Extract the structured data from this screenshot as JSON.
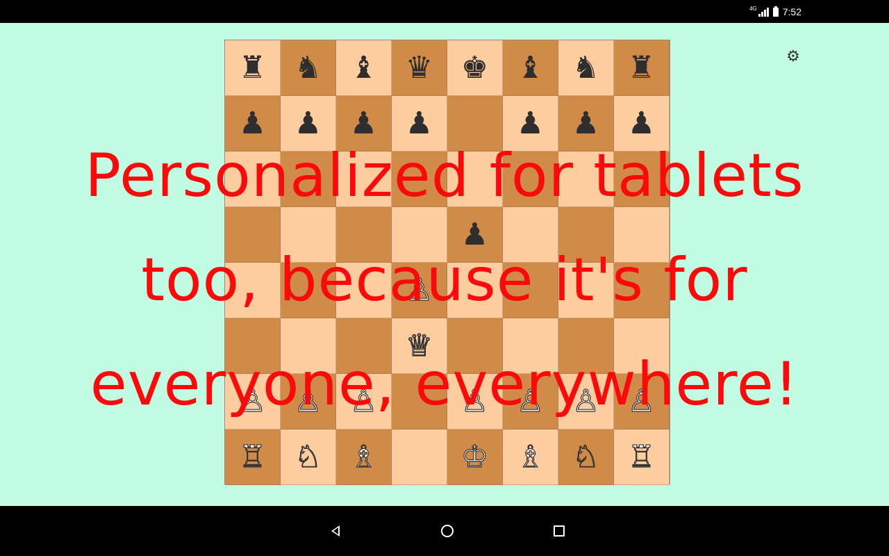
{
  "status_bar": {
    "network_label": "4G",
    "time": "7:52"
  },
  "toolbar": {
    "settings_icon": "gear-icon"
  },
  "board": {
    "light_color": "#fecd9f",
    "dark_color": "#d08b48",
    "rows": [
      [
        {
          "g": "♜",
          "c": "b"
        },
        {
          "g": "♞",
          "c": "b"
        },
        {
          "g": "♝",
          "c": "b"
        },
        {
          "g": "♛",
          "c": "b"
        },
        {
          "g": "♚",
          "c": "b"
        },
        {
          "g": "♝",
          "c": "b"
        },
        {
          "g": "♞",
          "c": "b"
        },
        {
          "g": "♜",
          "c": "b"
        }
      ],
      [
        {
          "g": "♟",
          "c": "b"
        },
        {
          "g": "♟",
          "c": "b"
        },
        {
          "g": "♟",
          "c": "b"
        },
        {
          "g": "♟",
          "c": "b"
        },
        {
          "g": "",
          "c": ""
        },
        {
          "g": "♟",
          "c": "b"
        },
        {
          "g": "♟",
          "c": "b"
        },
        {
          "g": "♟",
          "c": "b"
        }
      ],
      [
        {
          "g": "",
          "c": ""
        },
        {
          "g": "",
          "c": ""
        },
        {
          "g": "",
          "c": ""
        },
        {
          "g": "",
          "c": ""
        },
        {
          "g": "",
          "c": ""
        },
        {
          "g": "",
          "c": ""
        },
        {
          "g": "",
          "c": ""
        },
        {
          "g": "",
          "c": ""
        }
      ],
      [
        {
          "g": "",
          "c": ""
        },
        {
          "g": "",
          "c": ""
        },
        {
          "g": "",
          "c": ""
        },
        {
          "g": "",
          "c": ""
        },
        {
          "g": "♟",
          "c": "b"
        },
        {
          "g": "",
          "c": ""
        },
        {
          "g": "",
          "c": ""
        },
        {
          "g": "",
          "c": ""
        }
      ],
      [
        {
          "g": "",
          "c": ""
        },
        {
          "g": "",
          "c": ""
        },
        {
          "g": "",
          "c": ""
        },
        {
          "g": "♙",
          "c": "w"
        },
        {
          "g": "",
          "c": ""
        },
        {
          "g": "",
          "c": ""
        },
        {
          "g": "",
          "c": ""
        },
        {
          "g": "",
          "c": ""
        }
      ],
      [
        {
          "g": "",
          "c": ""
        },
        {
          "g": "",
          "c": ""
        },
        {
          "g": "",
          "c": ""
        },
        {
          "g": "♕",
          "c": "w"
        },
        {
          "g": "",
          "c": ""
        },
        {
          "g": "",
          "c": ""
        },
        {
          "g": "",
          "c": ""
        },
        {
          "g": "",
          "c": ""
        }
      ],
      [
        {
          "g": "♙",
          "c": "w"
        },
        {
          "g": "♙",
          "c": "w"
        },
        {
          "g": "♙",
          "c": "w"
        },
        {
          "g": "",
          "c": ""
        },
        {
          "g": "♙",
          "c": "w"
        },
        {
          "g": "♙",
          "c": "w"
        },
        {
          "g": "♙",
          "c": "w"
        },
        {
          "g": "♙",
          "c": "w"
        }
      ],
      [
        {
          "g": "♖",
          "c": "w"
        },
        {
          "g": "♘",
          "c": "w"
        },
        {
          "g": "♗",
          "c": "w"
        },
        {
          "g": "",
          "c": ""
        },
        {
          "g": "♔",
          "c": "w"
        },
        {
          "g": "♗",
          "c": "w"
        },
        {
          "g": "♘",
          "c": "w"
        },
        {
          "g": "♖",
          "c": "w"
        }
      ]
    ]
  },
  "promo": {
    "line1": "Personalized for tablets",
    "line2": "too, because it's for",
    "line3": "everyone, everywhere!",
    "color": "#fa0a0a"
  },
  "nav_bar": {
    "back_icon": "back-triangle-icon",
    "home_icon": "home-circle-icon",
    "recents_icon": "recents-square-icon"
  }
}
